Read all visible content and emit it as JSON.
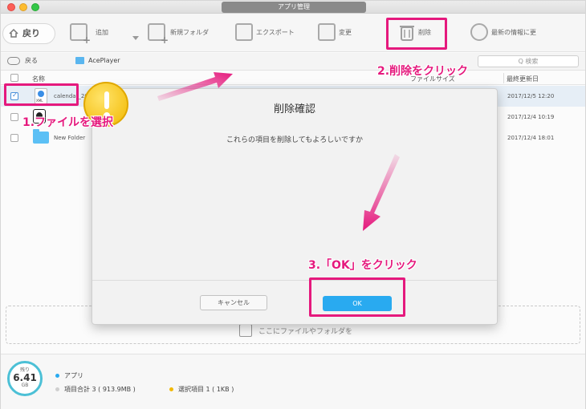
{
  "window": {
    "title": "アプリ管理"
  },
  "toolbar": {
    "back_label": "戻り",
    "add_label": "追加",
    "new_folder_label": "新規フォルダ",
    "export_label": "エクスポート",
    "rename_label": "変更",
    "delete_label": "削除",
    "refresh_label": "最新の情報に更"
  },
  "pathbar": {
    "back_label": "戻る",
    "folder": "AcePlayer",
    "search_placeholder": "Q 検索"
  },
  "columns": {
    "name": "名称",
    "kind": "ファイルサイズ",
    "modified": "最終更新日"
  },
  "files": [
    {
      "name": "calendar_201",
      "date": "2017/12/5  12:20",
      "checked": true
    },
    {
      "name": "",
      "date": "2017/12/4  10:19",
      "checked": false
    },
    {
      "name": "New Folder",
      "date": "2017/12/4  18:01",
      "checked": false
    }
  ],
  "dropzone": {
    "text": "ここにファイルやフォルダを"
  },
  "status": {
    "remaining_label": "残り",
    "remaining_value": "6.41",
    "remaining_unit": "GB",
    "apps_label": "アプリ",
    "total_label": "項目合計 3 ( 913.9MB )",
    "selected_label": "選択項目 1 ( 1KB )"
  },
  "dialog": {
    "title": "削除確認",
    "message": "これらの項目を削除してもよろしいですか",
    "cancel_label": "キャンセル",
    "ok_label": "OK"
  },
  "annotations": {
    "step1": "1.ファイルを選択",
    "step2": "2.削除をクリック",
    "step3": "3.「OK」をクリック"
  },
  "colors": {
    "highlight": "#e5197d",
    "ok_button": "#29aaf0",
    "gauge": "#4cc0d6"
  }
}
